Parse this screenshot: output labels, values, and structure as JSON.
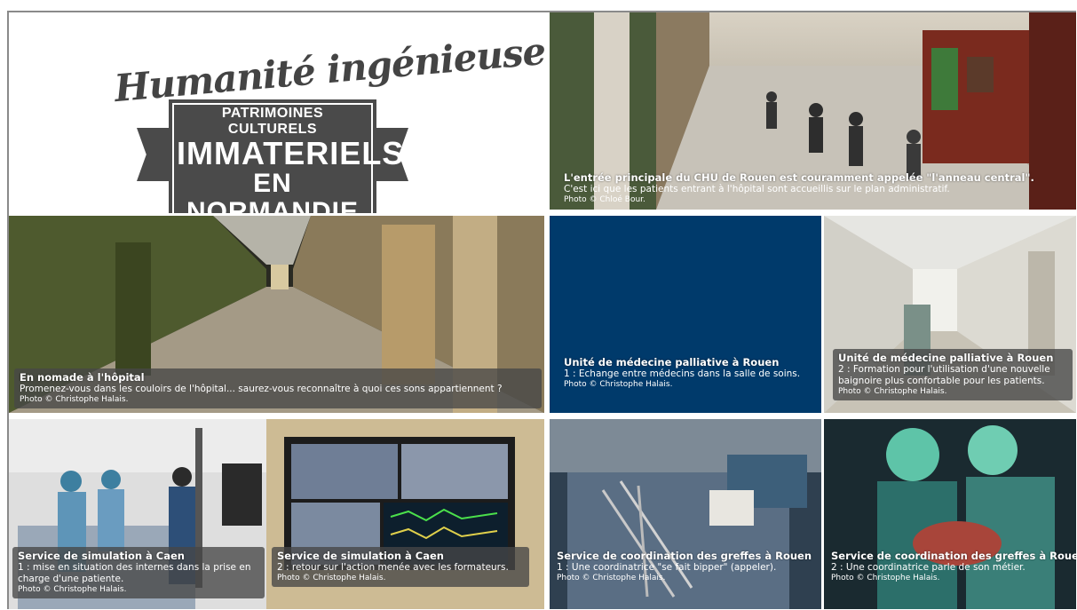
{
  "logo": {
    "script": "Humanité ingénieuse",
    "line1": "PATRIMOINES CULTURELS",
    "line2": "IMMATERIELS",
    "line3": "EN NORMANDIE"
  },
  "tiles": [
    {
      "title": "L'entrée principale du CHU de Rouen est couramment appelée \"l'anneau central\".",
      "desc": "C'est ici que les patients entrant à l'hôpital sont accueillis sur le plan administratif.",
      "credit": "Photo © Chloé Bour."
    },
    {
      "title": "En nomade à l'hôpital",
      "desc": "Promenez-vous dans les couloirs de l'hôpital... saurez-vous reconnaître à quoi ces sons appartiennent ?",
      "credit": "Photo © Christophe Halais."
    },
    {
      "title": "Unité de médecine palliative à Rouen",
      "desc": "1 : Echange entre médecins dans la salle de soins.",
      "credit": "Photo © Christophe Halais."
    },
    {
      "title": "Unité de médecine palliative à Rouen",
      "desc": "2 : Formation pour l'utilisation d'une nouvelle baignoire plus confortable pour les patients.",
      "credit": "Photo © Christophe Halais."
    },
    {
      "title": "Service de simulation à Caen",
      "desc": "1 : mise en situation des internes dans la prise en charge d'une patiente.",
      "credit": "Photo © Christophe Halais."
    },
    {
      "title": "Service de simulation à Caen",
      "desc": "2 : retour sur l'action menée avec les formateurs.",
      "credit": "Photo © Christophe Halais."
    },
    {
      "title": "Service de coordination des greffes à Rouen",
      "desc": "1 : Une coordinatrice \"se fait bipper\" (appeler).",
      "credit": "Photo © Christophe Halais."
    },
    {
      "title": "Service de coordination des greffes à Rouen",
      "desc": "2 : Une coordinatrice parle de son métier.",
      "credit": "Photo © Christophe Halais."
    }
  ],
  "colors": {
    "palliative_block": "#003a6b",
    "caption_bg": "#464646"
  }
}
